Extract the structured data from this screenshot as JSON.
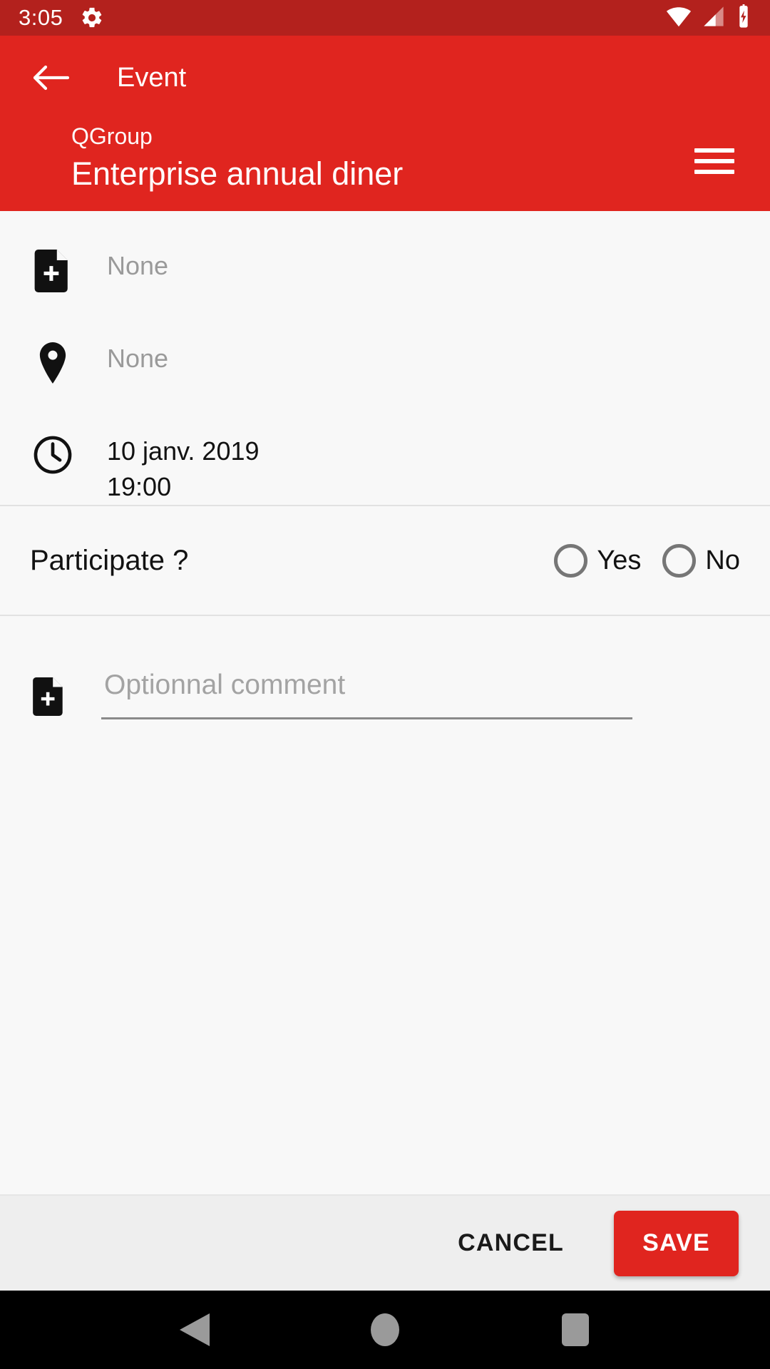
{
  "status_bar": {
    "time": "3:05",
    "icons": [
      "gear-icon",
      "wifi-icon",
      "cellular-signal-icon",
      "battery-charging-icon"
    ],
    "background": "#b3211d"
  },
  "app_bar": {
    "back_icon": "arrow-left-icon",
    "title": "Event",
    "group_name": "QGroup",
    "event_name": "Enterprise annual diner",
    "menu_icon": "hamburger-menu-icon",
    "background": "#e0251f"
  },
  "info_rows": [
    {
      "icon": "note-add-icon",
      "value": "None",
      "empty": true
    },
    {
      "icon": "location-pin-icon",
      "value": "None",
      "empty": true
    },
    {
      "icon": "clock-icon",
      "value": "10 janv. 2019\n19:00",
      "line1": "10 janv. 2019",
      "line2": "19:00",
      "empty": false
    }
  ],
  "participate": {
    "label": "Participate ?",
    "options": [
      {
        "label": "Yes",
        "selected": false
      },
      {
        "label": "No",
        "selected": false
      }
    ]
  },
  "comment": {
    "icon": "note-add-icon",
    "placeholder": "Optionnal comment",
    "value": ""
  },
  "actions": {
    "cancel_label": "CANCEL",
    "save_label": "SAVE",
    "save_color": "#e0251f"
  },
  "nav_bar": {
    "back_icon": "nav-back-triangle-icon",
    "home_icon": "nav-home-circle-icon",
    "recents_icon": "nav-recents-square-icon"
  }
}
